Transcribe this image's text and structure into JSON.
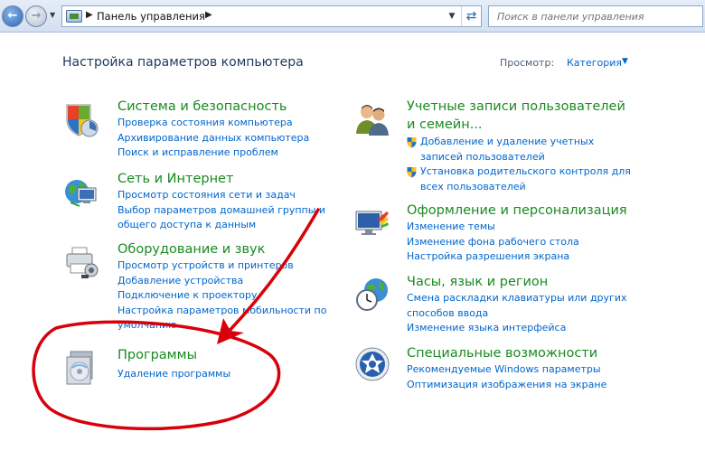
{
  "toolbar": {
    "breadcrumb": "Панель управления",
    "search_placeholder": "Поиск в панели управления"
  },
  "header": {
    "title": "Настройка параметров компьютера",
    "view_label": "Просмотр:",
    "view_value": "Категория"
  },
  "categories": {
    "system": {
      "title": "Система и безопасность",
      "links": [
        "Проверка состояния компьютера",
        "Архивирование данных компьютера",
        "Поиск и исправление проблем"
      ]
    },
    "network": {
      "title": "Сеть и Интернет",
      "links": [
        "Просмотр состояния сети и задач",
        "Выбор параметров домашней группы и общего доступа к данным"
      ]
    },
    "hardware": {
      "title": "Оборудование и звук",
      "links": [
        "Просмотр устройств и принтеров",
        "Добавление устройства",
        "Подключение к проектору",
        "Настройка параметров мобильности по умолчанию"
      ]
    },
    "programs": {
      "title": "Программы",
      "links": [
        "Удаление программы"
      ]
    },
    "accounts": {
      "title": "Учетные записи пользователей и семейн...",
      "links": [
        "Добавление и удаление учетных записей пользователей",
        "Установка родительского контроля для всех пользователей"
      ]
    },
    "appearance": {
      "title": "Оформление и персонализация",
      "links": [
        "Изменение темы",
        "Изменение фона рабочего стола",
        "Настройка разрешения экрана"
      ]
    },
    "clock": {
      "title": "Часы, язык и регион",
      "links": [
        "Смена раскладки клавиатуры или других способов ввода",
        "Изменение языка интерфейса"
      ]
    },
    "access": {
      "title": "Специальные возможности",
      "links": [
        "Рекомендуемые Windows параметры",
        "Оптимизация изображения на экране"
      ]
    }
  },
  "colors": {
    "category_title": "#1a8a22",
    "link": "#0066cc",
    "annotation": "#d8000b"
  }
}
